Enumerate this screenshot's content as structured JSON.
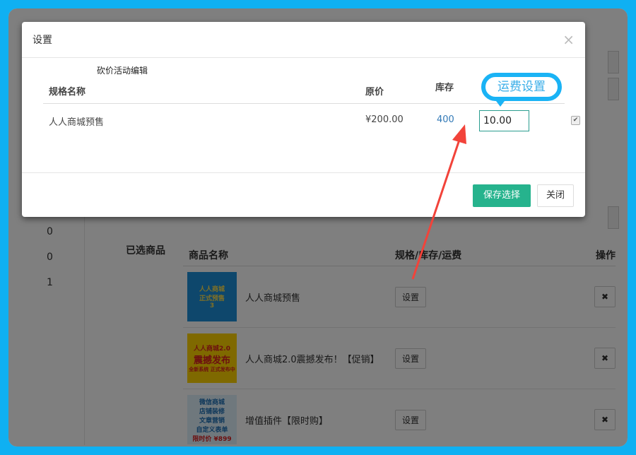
{
  "modal": {
    "title": "设置",
    "close_symbol": "×",
    "subtitle": "砍价活动编辑",
    "columns": {
      "name": "规格名称",
      "price": "原价",
      "stock": "库存"
    },
    "row": {
      "name": "人人商城预售",
      "price": "¥200.00",
      "stock": "400",
      "fee": "10.00",
      "checked": true
    },
    "callout_label": "运费设置",
    "save_label": "保存选择",
    "close_label": "关闭"
  },
  "background": {
    "left_numbers": [
      "0",
      "0",
      "1"
    ],
    "selected_label": "已选商品",
    "table_headers": {
      "name": "商品名称",
      "spec": "规格/库存/运费",
      "op": "操作"
    },
    "goods": [
      {
        "name": "人人商城预售",
        "button": "设置",
        "thumb_lines": [
          "人人商城",
          "正式预售",
          "3"
        ]
      },
      {
        "name": "人人商城2.0震撼发布！【促销】",
        "button": "设置",
        "thumb_lines": [
          "人人商城2.0",
          "震撼发布",
          "全新系统 正式发布中"
        ]
      },
      {
        "name": "增值插件【限时购】",
        "button": "设置",
        "thumb_lines": [
          "微信商城",
          "店铺装修",
          "文章营销",
          "自定义表单",
          "限时价 ¥899"
        ]
      }
    ],
    "delete_symbol": "✖"
  },
  "colors": {
    "accent": "#26b38d",
    "callout": "#1ab3f5",
    "arrow": "#f2433a",
    "frame": "#0fb0f2"
  }
}
